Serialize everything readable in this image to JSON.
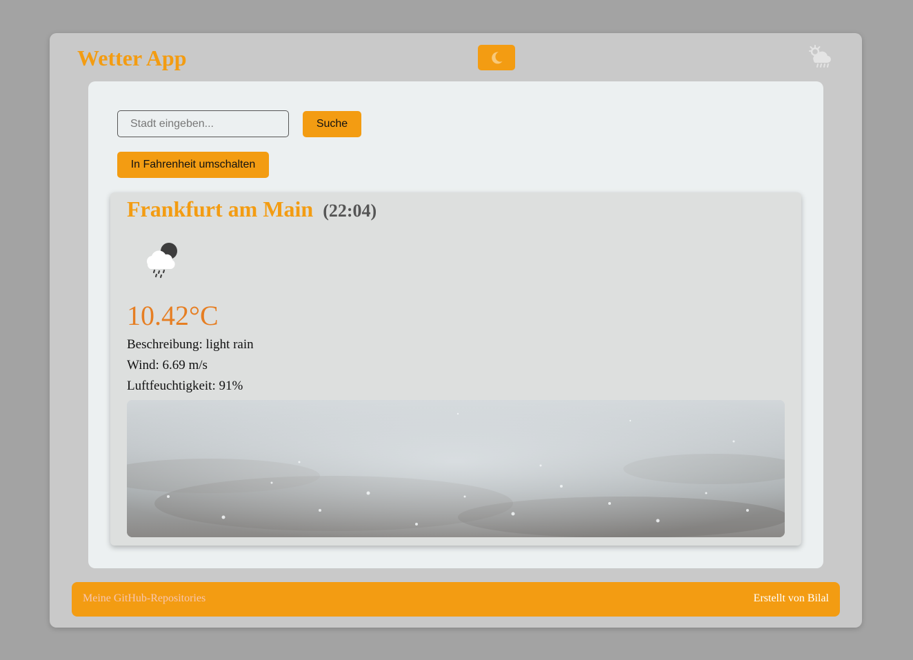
{
  "header": {
    "title": "Wetter App",
    "theme_toggle_icon": "moon-icon",
    "logo_icon": "sun-cloud-rain-icon"
  },
  "search": {
    "placeholder": "Stadt eingeben...",
    "value": "",
    "button_label": "Suche"
  },
  "unit_toggle": {
    "label": "In Fahrenheit umschalten"
  },
  "weather": {
    "city": "Frankfurt am Main",
    "time": "(22:04)",
    "icon": "night-cloud-rain-icon",
    "temperature": "10.42°C",
    "description": "Beschreibung: light rain",
    "wind": "Wind: 6.69 m/s",
    "humidity": "Luftfeuchtigkeit: 91%",
    "image": "rain-on-pavement-photo"
  },
  "footer": {
    "link_label": "Meine GitHub-Repositories",
    "credit": "Erstellt von Bilal"
  },
  "colors": {
    "page_background": "#a3a3a3",
    "shell_background": "#c9c9c9",
    "card_background": "#ecf0f1",
    "weather_card_background": "#dddfde",
    "accent": "#f39c12",
    "temperature": "#e67e22",
    "footer_link": "#f7c6b3"
  }
}
